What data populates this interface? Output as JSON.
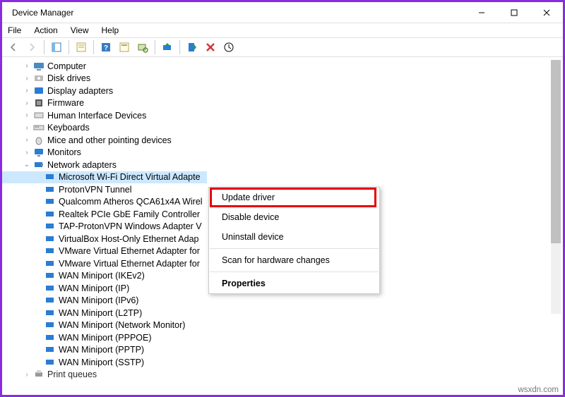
{
  "window": {
    "title": "Device Manager"
  },
  "menu": {
    "file": "File",
    "action": "Action",
    "view": "View",
    "help": "Help"
  },
  "tree": {
    "computer": "Computer",
    "disk_drives": "Disk drives",
    "display_adapters": "Display adapters",
    "firmware": "Firmware",
    "hid": "Human Interface Devices",
    "keyboards": "Keyboards",
    "mice": "Mice and other pointing devices",
    "monitors": "Monitors",
    "network_adapters": "Network adapters",
    "print_queues": "Print queues"
  },
  "network_adapters": {
    "items": [
      "Microsoft Wi-Fi Direct Virtual Adapte",
      "ProtonVPN Tunnel",
      "Qualcomm Atheros QCA61x4A Wirel",
      "Realtek PCIe GbE Family Controller",
      "TAP-ProtonVPN Windows Adapter V",
      "VirtualBox Host-Only Ethernet Adap",
      "VMware Virtual Ethernet Adapter for",
      "VMware Virtual Ethernet Adapter for",
      "WAN Miniport (IKEv2)",
      "WAN Miniport (IP)",
      "WAN Miniport (IPv6)",
      "WAN Miniport (L2TP)",
      "WAN Miniport (Network Monitor)",
      "WAN Miniport (PPPOE)",
      "WAN Miniport (PPTP)",
      "WAN Miniport (SSTP)"
    ]
  },
  "context_menu": {
    "update_driver": "Update driver",
    "disable": "Disable device",
    "uninstall": "Uninstall device",
    "scan": "Scan for hardware changes",
    "properties": "Properties"
  },
  "watermark": "wsxdn.com"
}
